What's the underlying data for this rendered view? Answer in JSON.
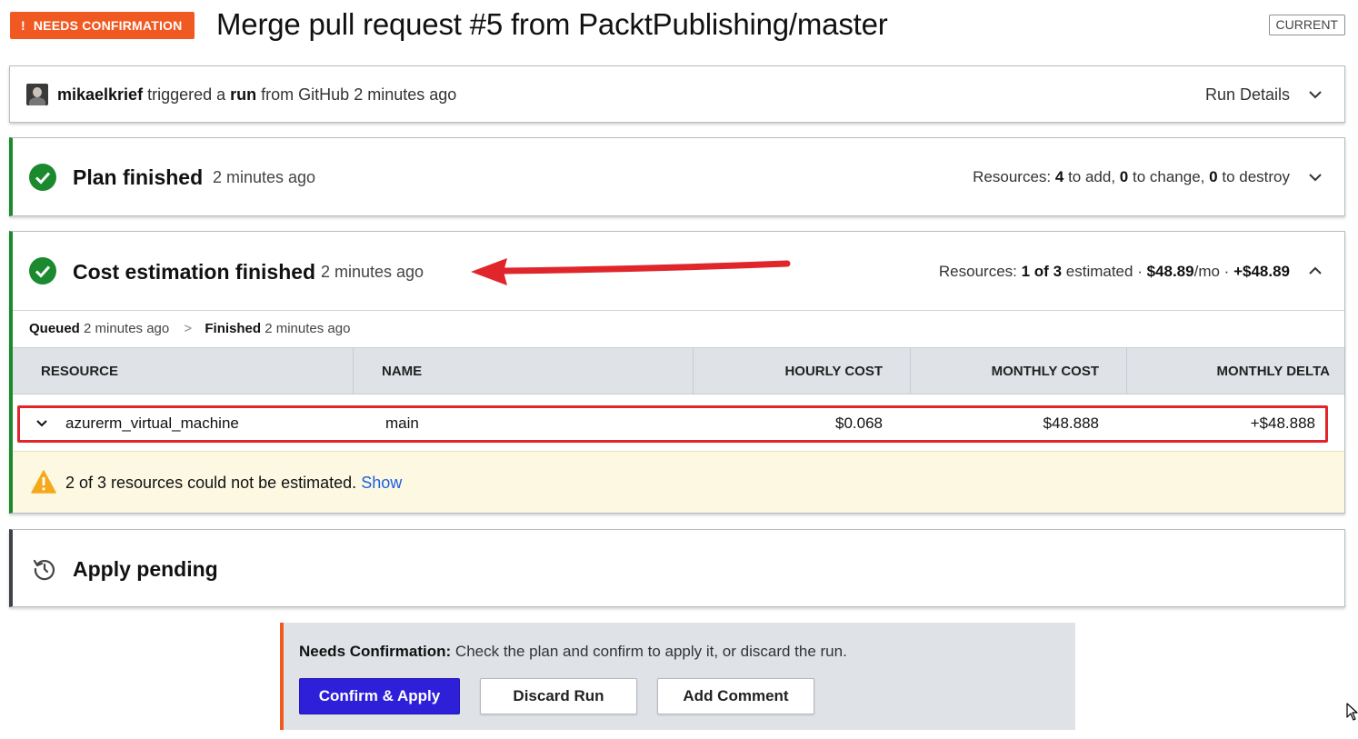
{
  "header": {
    "status_badge": "NEEDS CONFIRMATION",
    "status_icon": "!",
    "title": "Merge pull request #5 from PacktPublishing/master",
    "current_badge": "CURRENT"
  },
  "trigger": {
    "user": "mikaelkrief",
    "triggered_text": "triggered a",
    "run_word": "run",
    "source_text": "from GitHub 2 minutes ago",
    "run_details": "Run Details"
  },
  "plan": {
    "title": "Plan finished",
    "time": "2 minutes ago",
    "resources_label": "Resources:",
    "to_add": "4",
    "to_add_text": "to add,",
    "to_change": "0",
    "to_change_text": "to change,",
    "to_destroy": "0",
    "to_destroy_text": "to destroy"
  },
  "cost": {
    "title": "Cost estimation finished",
    "time": "2 minutes ago",
    "resources_label": "Resources:",
    "estimated_count": "1 of 3",
    "estimated_text": "estimated ·",
    "monthly": "$48.89",
    "per_month": "/mo ·",
    "delta": "+$48.89",
    "queued_label": "Queued",
    "queued_time": "2 minutes ago",
    "separator": ">",
    "finished_label": "Finished",
    "finished_time": "2 minutes ago",
    "table": {
      "columns": [
        "RESOURCE",
        "NAME",
        "HOURLY COST",
        "MONTHLY COST",
        "MONTHLY DELTA"
      ],
      "rows": [
        {
          "resource": "azurerm_virtual_machine",
          "name": "main",
          "hourly": "$0.068",
          "monthly": "$48.888",
          "delta": "+$48.888"
        }
      ]
    },
    "warning_text": "2 of 3 resources could not be estimated.",
    "warning_link": "Show"
  },
  "apply": {
    "title": "Apply pending"
  },
  "confirmation": {
    "label": "Needs Confirmation:",
    "text": "Check the plan and confirm to apply it, or discard the run.",
    "confirm_button": "Confirm & Apply",
    "discard_button": "Discard Run",
    "comment_button": "Add Comment"
  },
  "colors": {
    "accent_orange": "#f05a22",
    "success_green": "#1b8a2e",
    "primary_button": "#2d20d8",
    "highlight_red": "#e0262b",
    "warning_bg": "#fdf8e2"
  },
  "icons": {
    "avatar": "avatar",
    "check": "check-circle-icon",
    "chevron_down": "chevron-down-icon",
    "chevron_up": "chevron-up-icon",
    "warning": "warning-triangle-icon",
    "history": "history-icon",
    "arrow": "red-arrow-annotation",
    "cursor": "mouse-cursor-icon"
  }
}
